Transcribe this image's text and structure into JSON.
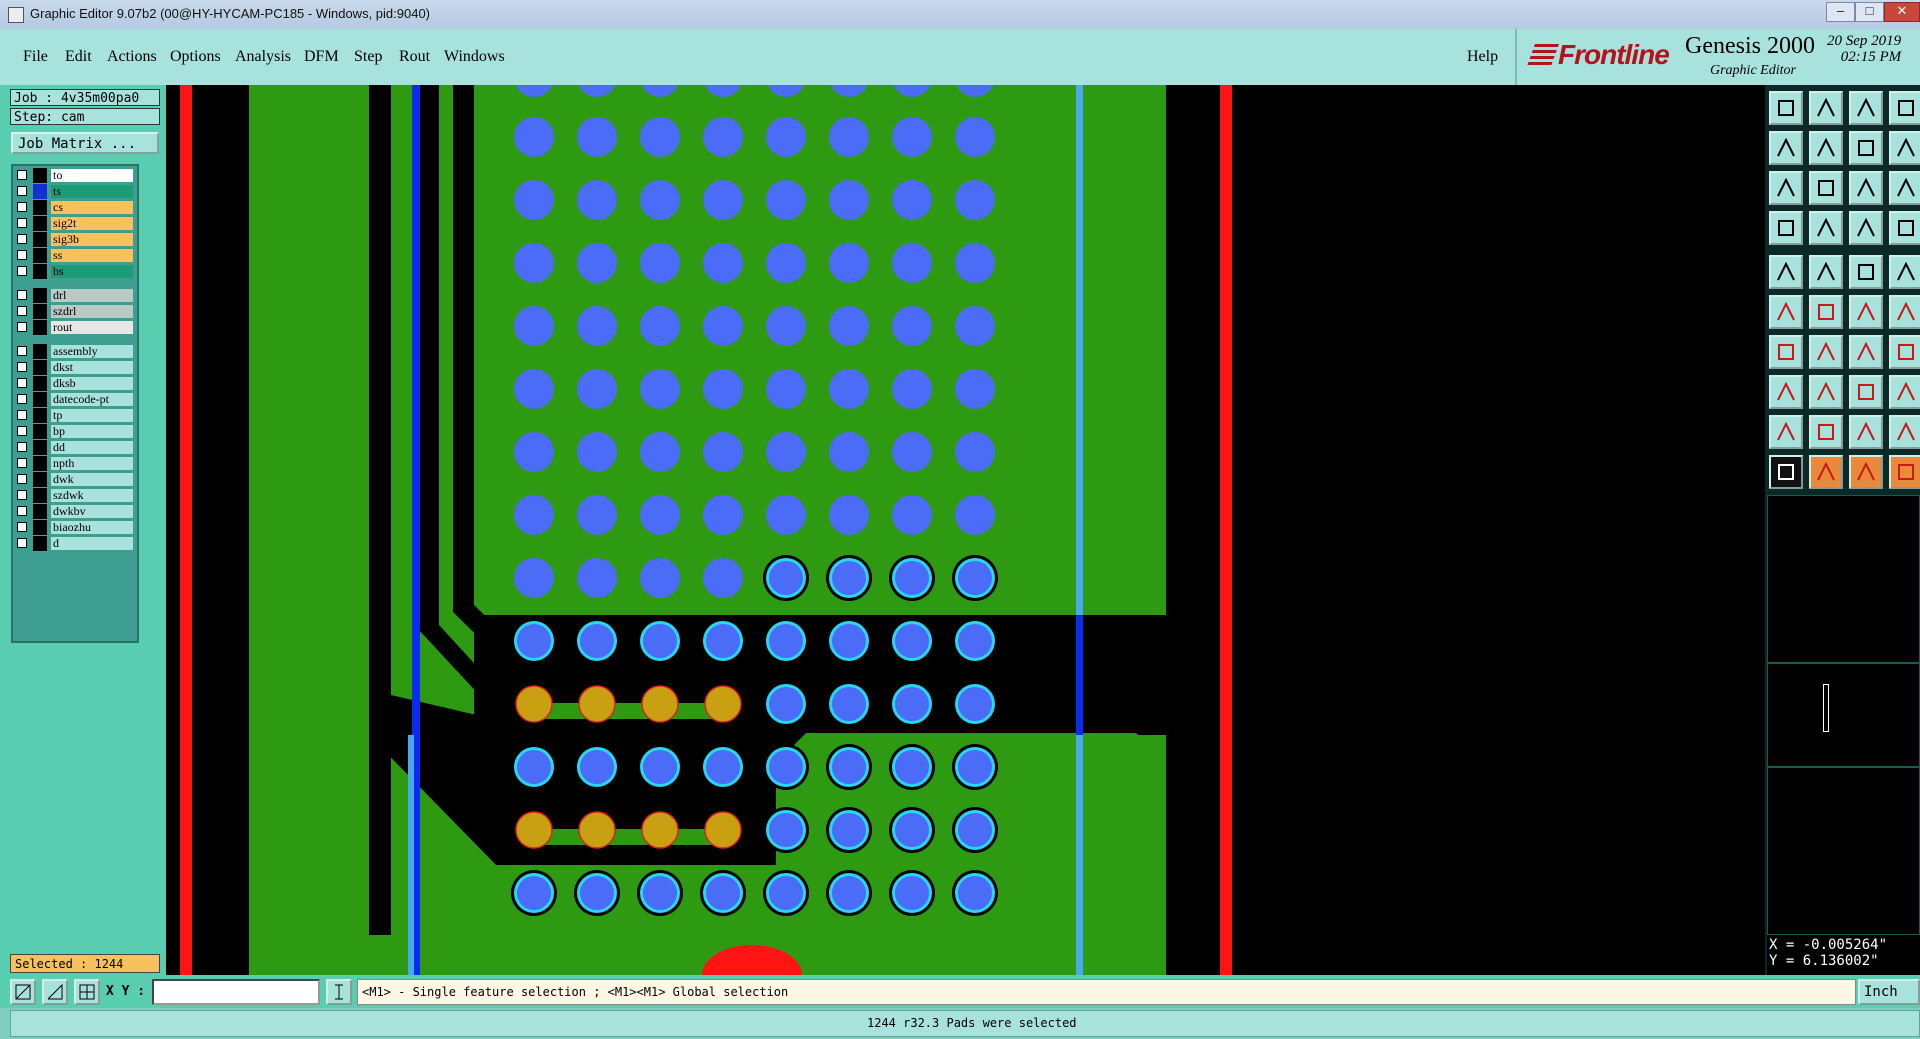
{
  "window": {
    "title": "Graphic Editor 9.07b2 (00@HY-HYCAM-PC185 - Windows, pid:9040)",
    "minimize": "–",
    "maximize": "□",
    "close": "✕"
  },
  "menu": {
    "items": [
      "File",
      "Edit",
      "Actions",
      "Options",
      "Analysis",
      "DFM",
      "Step",
      "Rout",
      "Windows"
    ],
    "help": "Help"
  },
  "brand": {
    "logo": "Frontline",
    "product": "Genesis 2000",
    "subtitle": "Graphic Editor",
    "date": "20 Sep 2019",
    "time": "02:15 PM"
  },
  "job": {
    "job_line": "Job : 4v35m00pa0",
    "step_line": "Step: cam",
    "job_matrix_button": "Job Matrix ..."
  },
  "layers": [
    {
      "name": "to",
      "color": "#ffffff"
    },
    {
      "name": "ts",
      "color": "#1b9b78"
    },
    {
      "name": "cs",
      "color": "#f7c15d"
    },
    {
      "name": "sig2t",
      "color": "#f7c15d"
    },
    {
      "name": "sig3b",
      "color": "#f7c15d"
    },
    {
      "name": "ss",
      "color": "#f7c15d"
    },
    {
      "name": "bs",
      "color": "#1b9b78"
    },
    {
      "name": "drl",
      "color": "#b8c9c6"
    },
    {
      "name": "szdrl",
      "color": "#b8c9c6"
    },
    {
      "name": "rout",
      "color": "#e6e6e6"
    },
    {
      "name": "assembly",
      "color": "#a8e2dc"
    },
    {
      "name": "dkst",
      "color": "#a8e2dc"
    },
    {
      "name": "dksb",
      "color": "#a8e2dc"
    },
    {
      "name": "datecode-pt",
      "color": "#a8e2dc"
    },
    {
      "name": "tp",
      "color": "#a8e2dc"
    },
    {
      "name": "bp",
      "color": "#a8e2dc"
    },
    {
      "name": "dd",
      "color": "#a8e2dc"
    },
    {
      "name": "npth",
      "color": "#a8e2dc"
    },
    {
      "name": "dwk",
      "color": "#a8e2dc"
    },
    {
      "name": "szdwk",
      "color": "#a8e2dc"
    },
    {
      "name": "dwkbv",
      "color": "#a8e2dc"
    },
    {
      "name": "biaozhu",
      "color": "#a8e2dc"
    },
    {
      "name": "d",
      "color": "#a8e2dc"
    }
  ],
  "selected_count": "Selected : 1244",
  "coords": {
    "x": "X = -0.005264\"",
    "y": "Y = 6.136002\""
  },
  "command": {
    "xy_label": "X Y :",
    "xy_value": "",
    "hint": "<M1> - Single feature selection ; <M1><M1> Global selection",
    "unit": "Inch"
  },
  "status": "1244 r32.3 Pads were selected",
  "colors": {
    "copper": "#2e9a12",
    "pad": "#4a6cf7",
    "pad_selected_ring": "#27d8f0",
    "pad_highlight": "#c8a012",
    "board_edge": "#ff1414",
    "trace_blue": "#0a2cf0",
    "trace_cyan": "#4aa8f0"
  },
  "toolbox_icons": [
    "zoom-home-icon",
    "zoom-fit-icon",
    "zoom-house-icon",
    "zoom-window-icon",
    "pan-left-icon",
    "pan-right-icon",
    "mirror-view-icon",
    "step-view-icon",
    "zoom-in-icon",
    "zoom-center-icon",
    "scale-1-2-icon",
    "help-query-icon",
    "measure-icon",
    "grid-icon",
    "snap-red-icon",
    "snap-dots-icon",
    "pad-add-icon",
    "line-add-icon",
    "text-add-icon",
    "surface-add-icon",
    "net-connect-icon",
    "cross-delete-icon",
    "node-move-icon",
    "vertex-icon",
    "angle-icon",
    "slope-line-icon",
    "arc-icon",
    "break-line-icon",
    "copy-icon",
    "dash-line-icon",
    "frame-select-icon",
    "group-icon",
    "triangle-icon",
    "triangle-arrow-icon",
    "triangle-dual-icon",
    "triangle-right-icon",
    "select-arrow-icon",
    "select-orange-icon",
    "select-alt-icon",
    "route-icon"
  ]
}
